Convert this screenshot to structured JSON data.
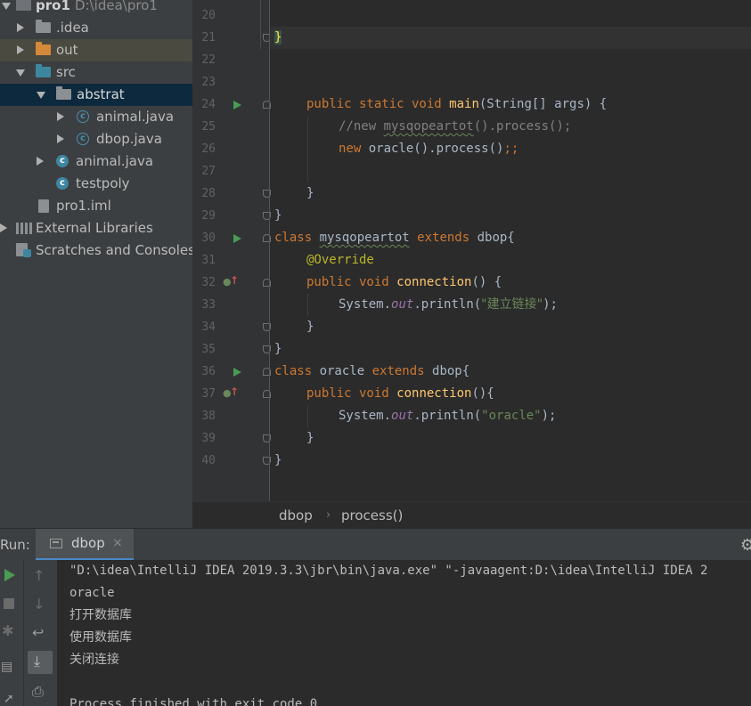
{
  "project_tree": {
    "root": {
      "name": "pro1",
      "path": "D:\\idea\\pro1"
    },
    "items": [
      {
        "label": "pro1"
      },
      {
        "label": ".idea"
      },
      {
        "label": "out"
      },
      {
        "label": "src"
      },
      {
        "label": "abstrat"
      },
      {
        "label": "animal.java"
      },
      {
        "label": "dbop.java"
      },
      {
        "label": "animal.java"
      },
      {
        "label": "testpoly"
      },
      {
        "label": "pro1.iml"
      },
      {
        "label": "External Libraries"
      },
      {
        "label": "Scratches and Consoles"
      }
    ]
  },
  "editor": {
    "line_numbers": [
      "20",
      "21",
      "22",
      "23",
      "24",
      "25",
      "26",
      "27",
      "28",
      "29",
      "30",
      "31",
      "32",
      "33",
      "34",
      "35",
      "36",
      "37",
      "38",
      "39",
      "40"
    ],
    "code": {
      "l21_brace": "}",
      "l24_kw": "public static void ",
      "l24_fn": "main",
      "l24_rest": "(String[] args) {",
      "l25_comment_a": "//new ",
      "l25_comment_b": "mysqopeartot",
      "l25_comment_c": "().process();",
      "l26_kw": "new ",
      "l26_rest": "oracle().process()",
      "l26_semi": ";;",
      "l28": "}",
      "l29": "}",
      "l30_kw": "class ",
      "l30_name": "mysqopeartot",
      "l30_kw2": " extends ",
      "l30_rest": "dbop{",
      "l31": "@Override",
      "l32_kw": "public void ",
      "l32_fn": "connection",
      "l32_rest": "() {",
      "l33_a": "System.",
      "l33_out": "out",
      "l33_b": ".println(",
      "l33_str": "\"建立链接\"",
      "l33_c": ");",
      "l34": "}",
      "l35": "}",
      "l36_kw": "class ",
      "l36_name": "oracle",
      "l36_kw2": " extends ",
      "l36_rest": "dbop{",
      "l37_kw": "public void ",
      "l37_fn": "connection",
      "l37_rest": "(){",
      "l38_a": "System.",
      "l38_out": "out",
      "l38_b": ".println(",
      "l38_str": "\"oracle\"",
      "l38_c": ");",
      "l39": "}",
      "l40": "}"
    }
  },
  "breadcrumb": {
    "class_name": "dbop",
    "separator": "›",
    "method": "process()"
  },
  "run_panel": {
    "title": "Run:",
    "tab_label": "dbop",
    "tab_close": "×",
    "console": [
      "\"D:\\idea\\IntelliJ IDEA 2019.3.3\\jbr\\bin\\java.exe\" \"-javaagent:D:\\idea\\IntelliJ IDEA 2",
      "oracle",
      "打开数据库",
      "使用数据库",
      "关闭连接",
      "",
      "Process finished with exit code 0"
    ]
  },
  "colors": {
    "keyword": "#cc7832",
    "function": "#ffc66d",
    "string": "#6a8759",
    "comment": "#808080",
    "annotation": "#bbb529",
    "field": "#9876aa",
    "run": "#499c54",
    "selection": "#0d293e"
  },
  "icons": {
    "run": "play-icon",
    "stop": "stop-icon",
    "settings": "gear-icon",
    "folder": "folder-icon",
    "class": "class-icon"
  }
}
